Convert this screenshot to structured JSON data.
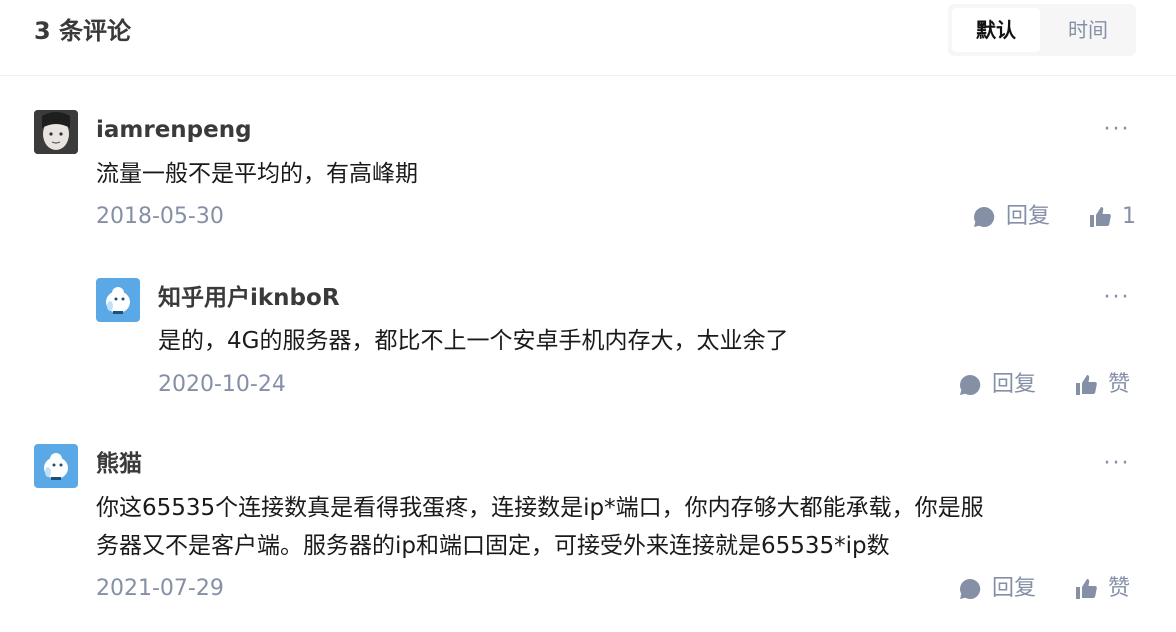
{
  "header": {
    "count_title": "3 条评论",
    "sort_default": "默认",
    "sort_time": "时间"
  },
  "comments": [
    {
      "author": "iamrenpeng",
      "content": "流量一般不是平均的，有高峰期",
      "date": "2018-05-30",
      "reply_label": "回复",
      "like_label": "1"
    },
    {
      "author": "知乎用户iknboR",
      "content": "是的，4G的服务器，都比不上一个安卓手机内存大，太业余了",
      "date": "2020-10-24",
      "reply_label": "回复",
      "like_label": "赞"
    },
    {
      "author": "熊猫",
      "content_line1": "你这65535个连接数真是看得我蛋疼，连接数是ip*端口，你内存够大都能承载，你是服",
      "content_line2": "务器又不是客户端。服务器的ip和端口固定，可接受外来连接就是65535*ip数",
      "date": "2021-07-29",
      "reply_label": "回复",
      "like_label": "赞"
    }
  ],
  "colors": {
    "meta_gray": "#8590a6",
    "avatar_blue": "#5aa9e6"
  },
  "icons": {
    "reply": "speech-bubble-icon",
    "like": "thumbs-up-icon",
    "more": "ellipsis-icon"
  }
}
